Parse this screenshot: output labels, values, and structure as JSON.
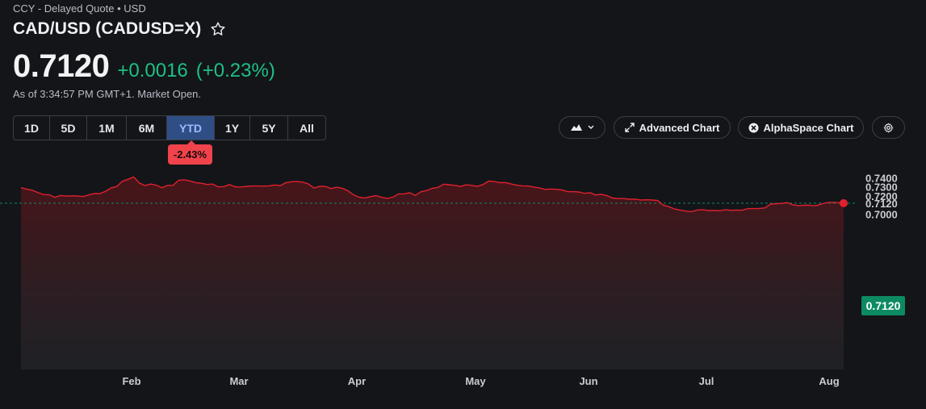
{
  "header": {
    "meta": "CCY - Delayed Quote • USD",
    "title": "CAD/USD (CADUSD=X)",
    "price": "0.7120",
    "change": "+0.0016",
    "change_pct": "(+0.23%)",
    "as_of": "As of 3:34:57 PM GMT+1. Market Open."
  },
  "ranges": [
    {
      "label": "1D"
    },
    {
      "label": "5D"
    },
    {
      "label": "1M"
    },
    {
      "label": "6M"
    },
    {
      "label": "YTD",
      "active": true
    },
    {
      "label": "1Y"
    },
    {
      "label": "5Y"
    },
    {
      "label": "All"
    }
  ],
  "ytd_change": "-2.43%",
  "toolbar": {
    "chart_type_icon": "mountain-chart-icon",
    "advanced_chart": "Advanced Chart",
    "alphaspace_chart": "AlphaSpace Chart",
    "settings_icon": "gear-icon"
  },
  "colors": {
    "line": "#e0202e",
    "positive": "#1ec083",
    "negative": "#f1434b",
    "active_tab": "#2f4e86",
    "reference_line": "#0d8a62"
  },
  "chart_data": {
    "type": "area",
    "title": "",
    "xlabel": "",
    "ylabel": "",
    "x_ticks": [
      "Feb",
      "Mar",
      "Apr",
      "May",
      "Jun",
      "Jul",
      "Aug"
    ],
    "y_ticks": [
      "0.7400",
      "0.7300",
      "0.7200",
      "0.7120",
      "0.7000"
    ],
    "ylim": [
      0.697,
      0.744
    ],
    "current_value": "0.7120",
    "current_line": 0.712,
    "series": [
      {
        "values": [
          0.7291,
          0.7276,
          0.7263,
          0.7238,
          0.7215,
          0.7213,
          0.7185,
          0.7205,
          0.7198,
          0.7202,
          0.72,
          0.7194,
          0.7211,
          0.7228,
          0.7226,
          0.7252,
          0.7289,
          0.7305,
          0.7363,
          0.7384,
          0.7411,
          0.7344,
          0.7315,
          0.7332,
          0.732,
          0.7291,
          0.7317,
          0.7318,
          0.7374,
          0.7379,
          0.7366,
          0.7347,
          0.7341,
          0.7327,
          0.7332,
          0.73,
          0.7304,
          0.7327,
          0.7302,
          0.7299,
          0.7306,
          0.731,
          0.731,
          0.7309,
          0.7312,
          0.7321,
          0.7314,
          0.7347,
          0.7357,
          0.7361,
          0.7353,
          0.7333,
          0.7288,
          0.7307,
          0.7305,
          0.7282,
          0.7296,
          0.7286,
          0.7258,
          0.7213,
          0.7186,
          0.7178,
          0.7192,
          0.7204,
          0.7185,
          0.7173,
          0.7187,
          0.7222,
          0.7223,
          0.7236,
          0.7207,
          0.7246,
          0.726,
          0.7285,
          0.7295,
          0.733,
          0.7324,
          0.7317,
          0.7306,
          0.7323,
          0.7317,
          0.7306,
          0.7327,
          0.7364,
          0.7361,
          0.7347,
          0.7348,
          0.7332,
          0.7319,
          0.7312,
          0.731,
          0.7299,
          0.7289,
          0.7272,
          0.7277,
          0.7273,
          0.7266,
          0.7247,
          0.7247,
          0.7244,
          0.7229,
          0.7237,
          0.7212,
          0.7219,
          0.7203,
          0.7177,
          0.7171,
          0.7171,
          0.7163,
          0.7165,
          0.7155,
          0.7158,
          0.7155,
          0.7149,
          0.7097,
          0.7081,
          0.7055,
          0.7044,
          0.7032,
          0.7026,
          0.7045,
          0.7048,
          0.7038,
          0.704,
          0.7037,
          0.7048,
          0.7041,
          0.7043,
          0.7042,
          0.706,
          0.706,
          0.7062,
          0.7068,
          0.7109,
          0.7114,
          0.7117,
          0.7128,
          0.7101,
          0.7093,
          0.7098,
          0.7097,
          0.709,
          0.711,
          0.7126,
          0.713,
          0.7126,
          0.712
        ]
      }
    ]
  }
}
